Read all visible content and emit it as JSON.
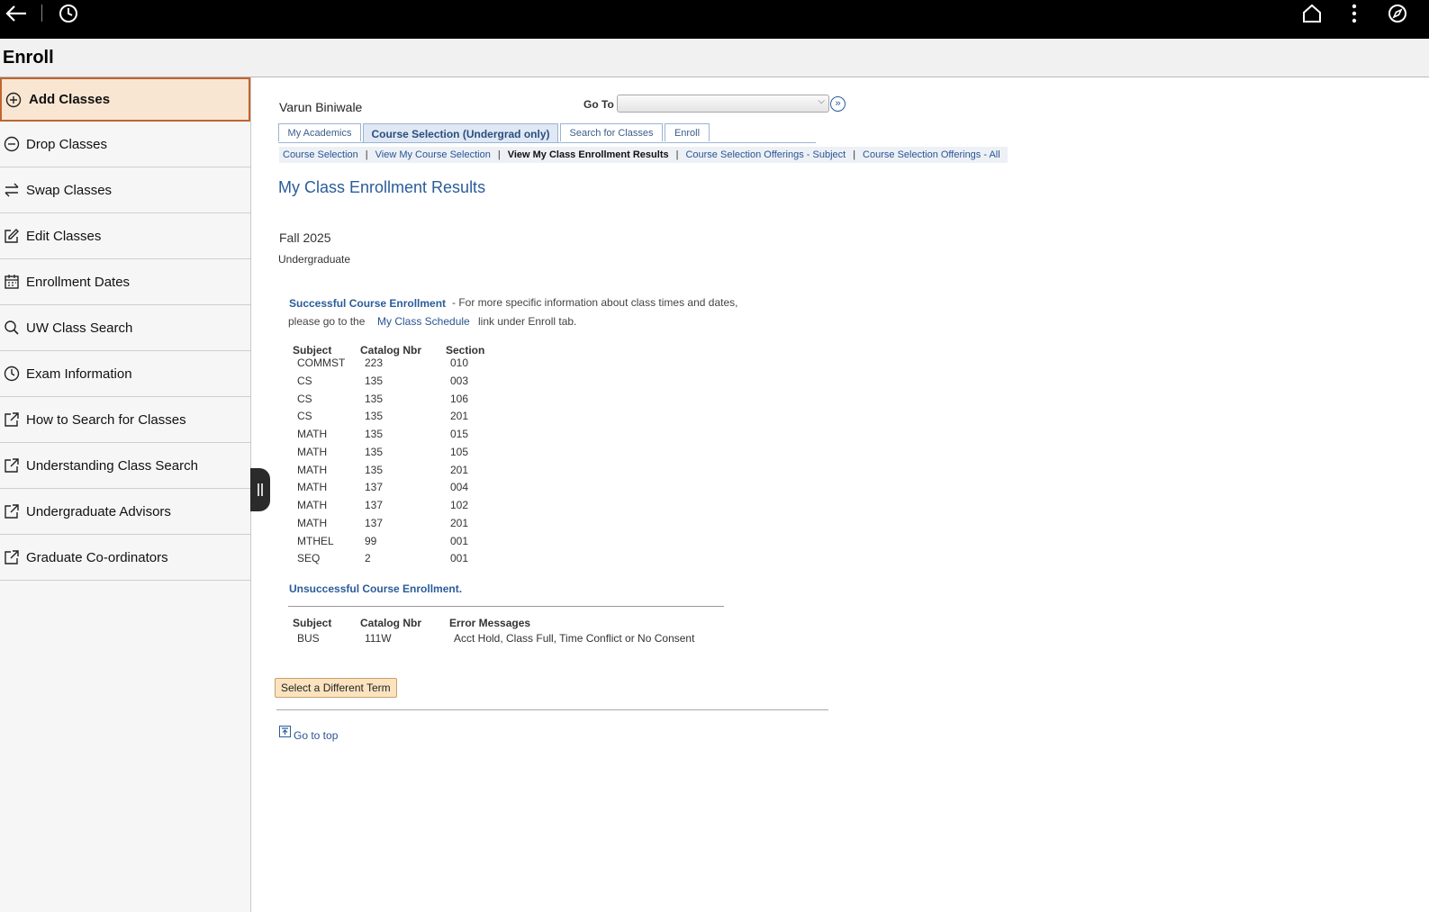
{
  "topbar": {
    "back_icon": "back-arrow-icon",
    "history_icon": "clock-icon",
    "home_icon": "home-icon",
    "menu_icon": "more-vertical-icon",
    "compass_icon": "compass-icon"
  },
  "titlebar": {
    "title": "Enroll"
  },
  "sidebar": {
    "items": [
      {
        "label": "Add Classes",
        "icon": "plus-circle-icon"
      },
      {
        "label": "Drop Classes",
        "icon": "minus-circle-icon"
      },
      {
        "label": "Swap Classes",
        "icon": "swap-icon"
      },
      {
        "label": "Edit Classes",
        "icon": "edit-icon"
      },
      {
        "label": "Enrollment Dates",
        "icon": "calendar-icon"
      },
      {
        "label": "UW Class Search",
        "icon": "search-icon"
      },
      {
        "label": "Exam Information",
        "icon": "clock-icon"
      },
      {
        "label": "How to Search for Classes",
        "icon": "external-link-icon"
      },
      {
        "label": "Understanding Class Search",
        "icon": "external-link-icon"
      },
      {
        "label": "Undergraduate Advisors",
        "icon": "external-link-icon"
      },
      {
        "label": "Graduate Co-ordinators",
        "icon": "external-link-icon"
      }
    ]
  },
  "main": {
    "user_name": "Varun Biniwale",
    "goto_label": "Go To",
    "tabs": [
      {
        "label": "My Academics"
      },
      {
        "label": "Course Selection (Undergrad only)"
      },
      {
        "label": "Search for Classes"
      },
      {
        "label": "Enroll"
      }
    ],
    "subnav": [
      "Course Selection",
      "View My Course Selection",
      "View My Class Enrollment Results",
      "Course Selection Offerings - Subject",
      "Course Selection Offerings - All"
    ],
    "page_title": "My Class Enrollment Results",
    "term": "Fall 2025",
    "career": "Undergraduate",
    "success": {
      "heading": "Successful Course Enrollment",
      "info_part1": "- For more specific information about class times and dates,",
      "info_part2": "please go to the",
      "schedule_link": "My Class Schedule",
      "info_part3": "link under Enroll tab.",
      "headers": {
        "subject": "Subject",
        "catalog": "Catalog Nbr",
        "section": "Section"
      },
      "rows": [
        {
          "subject": "COMMST",
          "catalog": "223",
          "section": "010"
        },
        {
          "subject": "CS",
          "catalog": "135",
          "section": "003"
        },
        {
          "subject": "CS",
          "catalog": "135",
          "section": "106"
        },
        {
          "subject": "CS",
          "catalog": "135",
          "section": "201"
        },
        {
          "subject": "MATH",
          "catalog": "135",
          "section": "015"
        },
        {
          "subject": "MATH",
          "catalog": "135",
          "section": "105"
        },
        {
          "subject": "MATH",
          "catalog": "135",
          "section": "201"
        },
        {
          "subject": "MATH",
          "catalog": "137",
          "section": "004"
        },
        {
          "subject": "MATH",
          "catalog": "137",
          "section": "102"
        },
        {
          "subject": "MATH",
          "catalog": "137",
          "section": "201"
        },
        {
          "subject": "MTHEL",
          "catalog": "99",
          "section": "001"
        },
        {
          "subject": "SEQ",
          "catalog": "2",
          "section": "001"
        }
      ]
    },
    "unsuccess": {
      "heading": "Unsuccessful Course Enrollment.",
      "headers": {
        "subject": "Subject",
        "catalog": "Catalog Nbr",
        "errors": "Error Messages"
      },
      "rows": [
        {
          "subject": "BUS",
          "catalog": "111W",
          "errors": "Acct Hold, Class Full, Time Conflict or No Consent"
        }
      ]
    },
    "select_term_button": "Select a Different Term",
    "go_to_top": "Go to top"
  }
}
